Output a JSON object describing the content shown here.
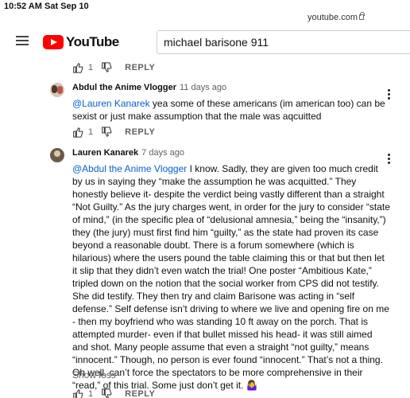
{
  "status": {
    "time": "10:52 AM",
    "date": "Sat Sep 10"
  },
  "browser": {
    "domain": "youtube.com"
  },
  "header": {
    "logo_text": "YouTube",
    "search_value": "michael barisone 911"
  },
  "actions": {
    "like_count": "1",
    "reply_label": "REPLY"
  },
  "comments": [
    {
      "author": "Abdul the Anime Vlogger",
      "time": "11 days ago",
      "mention": "@Lauren Kanarek",
      "text": " yea some of these americans (im american too) can be sexist or just make assumption that the male was aqcuitted",
      "likes": "1"
    },
    {
      "author": "Lauren Kanarek",
      "time": "7 days ago",
      "mention": "@Abdul the Anime Vlogger",
      "text": " I know. Sadly, they are given too much credit by us in saying they “make the assumption he was acquitted.” They honestly believe it- despite the verdict being vastly different than a straight “Not Guilty.” As the jury charges went, in order for the jury to consider “state of mind,” (in the specific plea of “delusional amnesia,” being the “insanity,”) they (the jury) must first find him “guilty,” as the state had proven its case beyond a reasonable doubt. There is a forum somewhere (which is hilarious) where the users pound the table claiming this or that but then let it slip that they didn’t even watch the trial! One poster “Ambitious Kate,” tripled down on the notion that the social worker from CPS did not testify. She did testify. They then try and claim Barisone was acting in “self defense.” Self defense isn’t driving to where we live and opening fire on me - then my boyfriend who was standing 10 ft away on the porch. That is attempted murder- even if that bullet missed his head- it was still aimed and shot. Many people assume that even a straight “not guilty,” means “innocent.” Though, no person is ever found “innocent.” That’s not a thing. Oh well, can’t force the spectators to be more comprehensive in their “read,” of this trial. Some just don’t get it. 🤷‍♀️",
      "show_less": "Show less"
    }
  ]
}
